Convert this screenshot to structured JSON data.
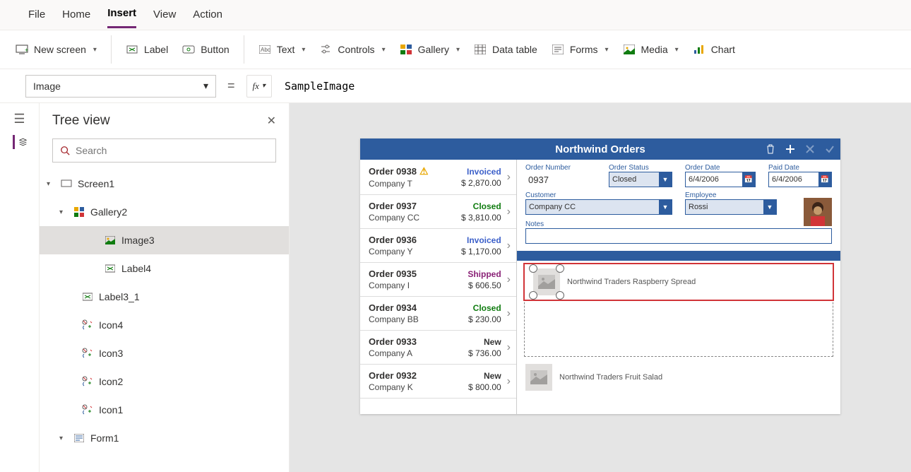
{
  "tabs": {
    "file": "File",
    "home": "Home",
    "insert": "Insert",
    "view": "View",
    "action": "Action",
    "active": "insert"
  },
  "ribbon": {
    "new_screen": "New screen",
    "label": "Label",
    "button": "Button",
    "text": "Text",
    "controls": "Controls",
    "gallery": "Gallery",
    "data_table": "Data table",
    "forms": "Forms",
    "media": "Media",
    "chart": "Chart"
  },
  "formula_bar": {
    "property": "Image",
    "fx": "fx",
    "formula": "SampleImage"
  },
  "tree": {
    "title": "Tree view",
    "search_placeholder": "Search",
    "items": {
      "screen1": "Screen1",
      "gallery2": "Gallery2",
      "image3": "Image3",
      "label4": "Label4",
      "label3_1": "Label3_1",
      "icon4": "Icon4",
      "icon3": "Icon3",
      "icon2": "Icon2",
      "icon1": "Icon1",
      "form1": "Form1"
    }
  },
  "app": {
    "title": "Northwind Orders",
    "labels": {
      "order_number": "Order Number",
      "order_status": "Order Status",
      "order_date": "Order Date",
      "paid_date": "Paid Date",
      "customer": "Customer",
      "employee": "Employee",
      "notes": "Notes"
    },
    "detail": {
      "order_number": "0937",
      "order_status": "Closed",
      "order_date": "6/4/2006",
      "paid_date": "6/4/2006",
      "customer": "Company CC",
      "employee": "Rossi"
    },
    "orders": [
      {
        "id": "Order 0938",
        "company": "Company T",
        "status": "Invoiced",
        "amount": "$ 2,870.00",
        "warn": true
      },
      {
        "id": "Order 0937",
        "company": "Company CC",
        "status": "Closed",
        "amount": "$ 3,810.00"
      },
      {
        "id": "Order 0936",
        "company": "Company Y",
        "status": "Invoiced",
        "amount": "$ 1,170.00"
      },
      {
        "id": "Order 0935",
        "company": "Company I",
        "status": "Shipped",
        "amount": "$ 606.50"
      },
      {
        "id": "Order 0934",
        "company": "Company BB",
        "status": "Closed",
        "amount": "$ 230.00"
      },
      {
        "id": "Order 0933",
        "company": "Company A",
        "status": "New",
        "amount": "$ 736.00"
      },
      {
        "id": "Order 0932",
        "company": "Company K",
        "status": "New",
        "amount": "$ 800.00"
      }
    ],
    "line_items": [
      {
        "name": "Northwind Traders Raspberry Spread"
      },
      {
        "name": "Northwind Traders Fruit Salad"
      }
    ]
  }
}
